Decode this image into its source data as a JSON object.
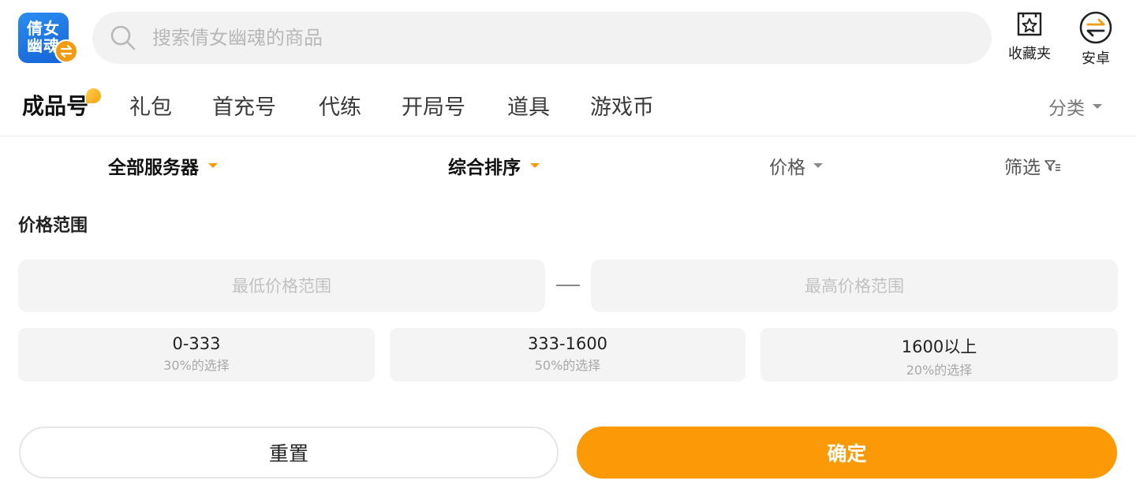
{
  "header": {
    "app_logo": {
      "icon": "app-logo-icon",
      "text_line1": "倩女",
      "text_line2": "幽魂",
      "badge_icon": "swap-arrows-icon"
    },
    "search": {
      "placeholder": "搜索倩女幽魂的商品",
      "icon": "search-icon"
    },
    "favorites": {
      "label": "收藏夹",
      "icon": "star-box-icon"
    },
    "android": {
      "label": "安卓",
      "icon": "swap-arrows-circle-icon"
    }
  },
  "category_tabs": {
    "items": [
      {
        "label": "成品号",
        "active": true
      },
      {
        "label": "礼包"
      },
      {
        "label": "首充号"
      },
      {
        "label": "代练"
      },
      {
        "label": "开局号"
      },
      {
        "label": "道具"
      },
      {
        "label": "游戏币"
      }
    ],
    "more_label": "分类"
  },
  "filter_bar": {
    "server": "全部服务器",
    "sort": "综合排序",
    "price": "价格",
    "filter": "筛选"
  },
  "price_range": {
    "title": "价格范围",
    "min_placeholder": "最低价格范围",
    "max_placeholder": "最高价格范围",
    "presets": [
      {
        "range": "0-333",
        "share": "30%的选择"
      },
      {
        "range": "333-1600",
        "share": "50%的选择"
      },
      {
        "range": "1600以上",
        "share": "20%的选择"
      }
    ]
  },
  "actions": {
    "reset_label": "重置",
    "confirm_label": "确定"
  },
  "colors": {
    "accent": "#fb9a06",
    "logo_blue": "#1e78e6",
    "search_bg": "#f2f2f2",
    "panel_bg": "#f4f4f4"
  }
}
